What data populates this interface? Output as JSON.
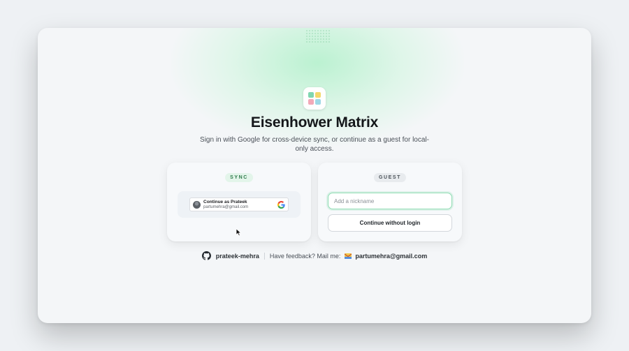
{
  "app": {
    "title": "Eisenhower Matrix",
    "subtitle": "Sign in with Google for cross-device sync, or continue as a guest for local-only access."
  },
  "logo": {
    "icon": "matrix-grid-icon",
    "colors": [
      "#7fd6b0",
      "#f3d86b",
      "#f2a9b8",
      "#9fd8e6"
    ]
  },
  "sync_card": {
    "tag": "SYNC",
    "google_button": {
      "name": "Continue as Prateek",
      "email": "partumehra@gmail.com",
      "icon": "google-logo-icon"
    }
  },
  "guest_card": {
    "tag": "GUEST",
    "nickname_input": {
      "placeholder": "Add a nickname",
      "value": ""
    },
    "continue_label": "Continue without login"
  },
  "footer": {
    "github_icon": "github-icon",
    "github_user": "prateek-mehra",
    "feedback_text": "Have feedback? Mail me:",
    "mail_icon": "envelope-icon",
    "email": "partumehra@gmail.com"
  },
  "colors": {
    "accent_green": "#8fdcb3",
    "background": "#f4f6f8"
  }
}
